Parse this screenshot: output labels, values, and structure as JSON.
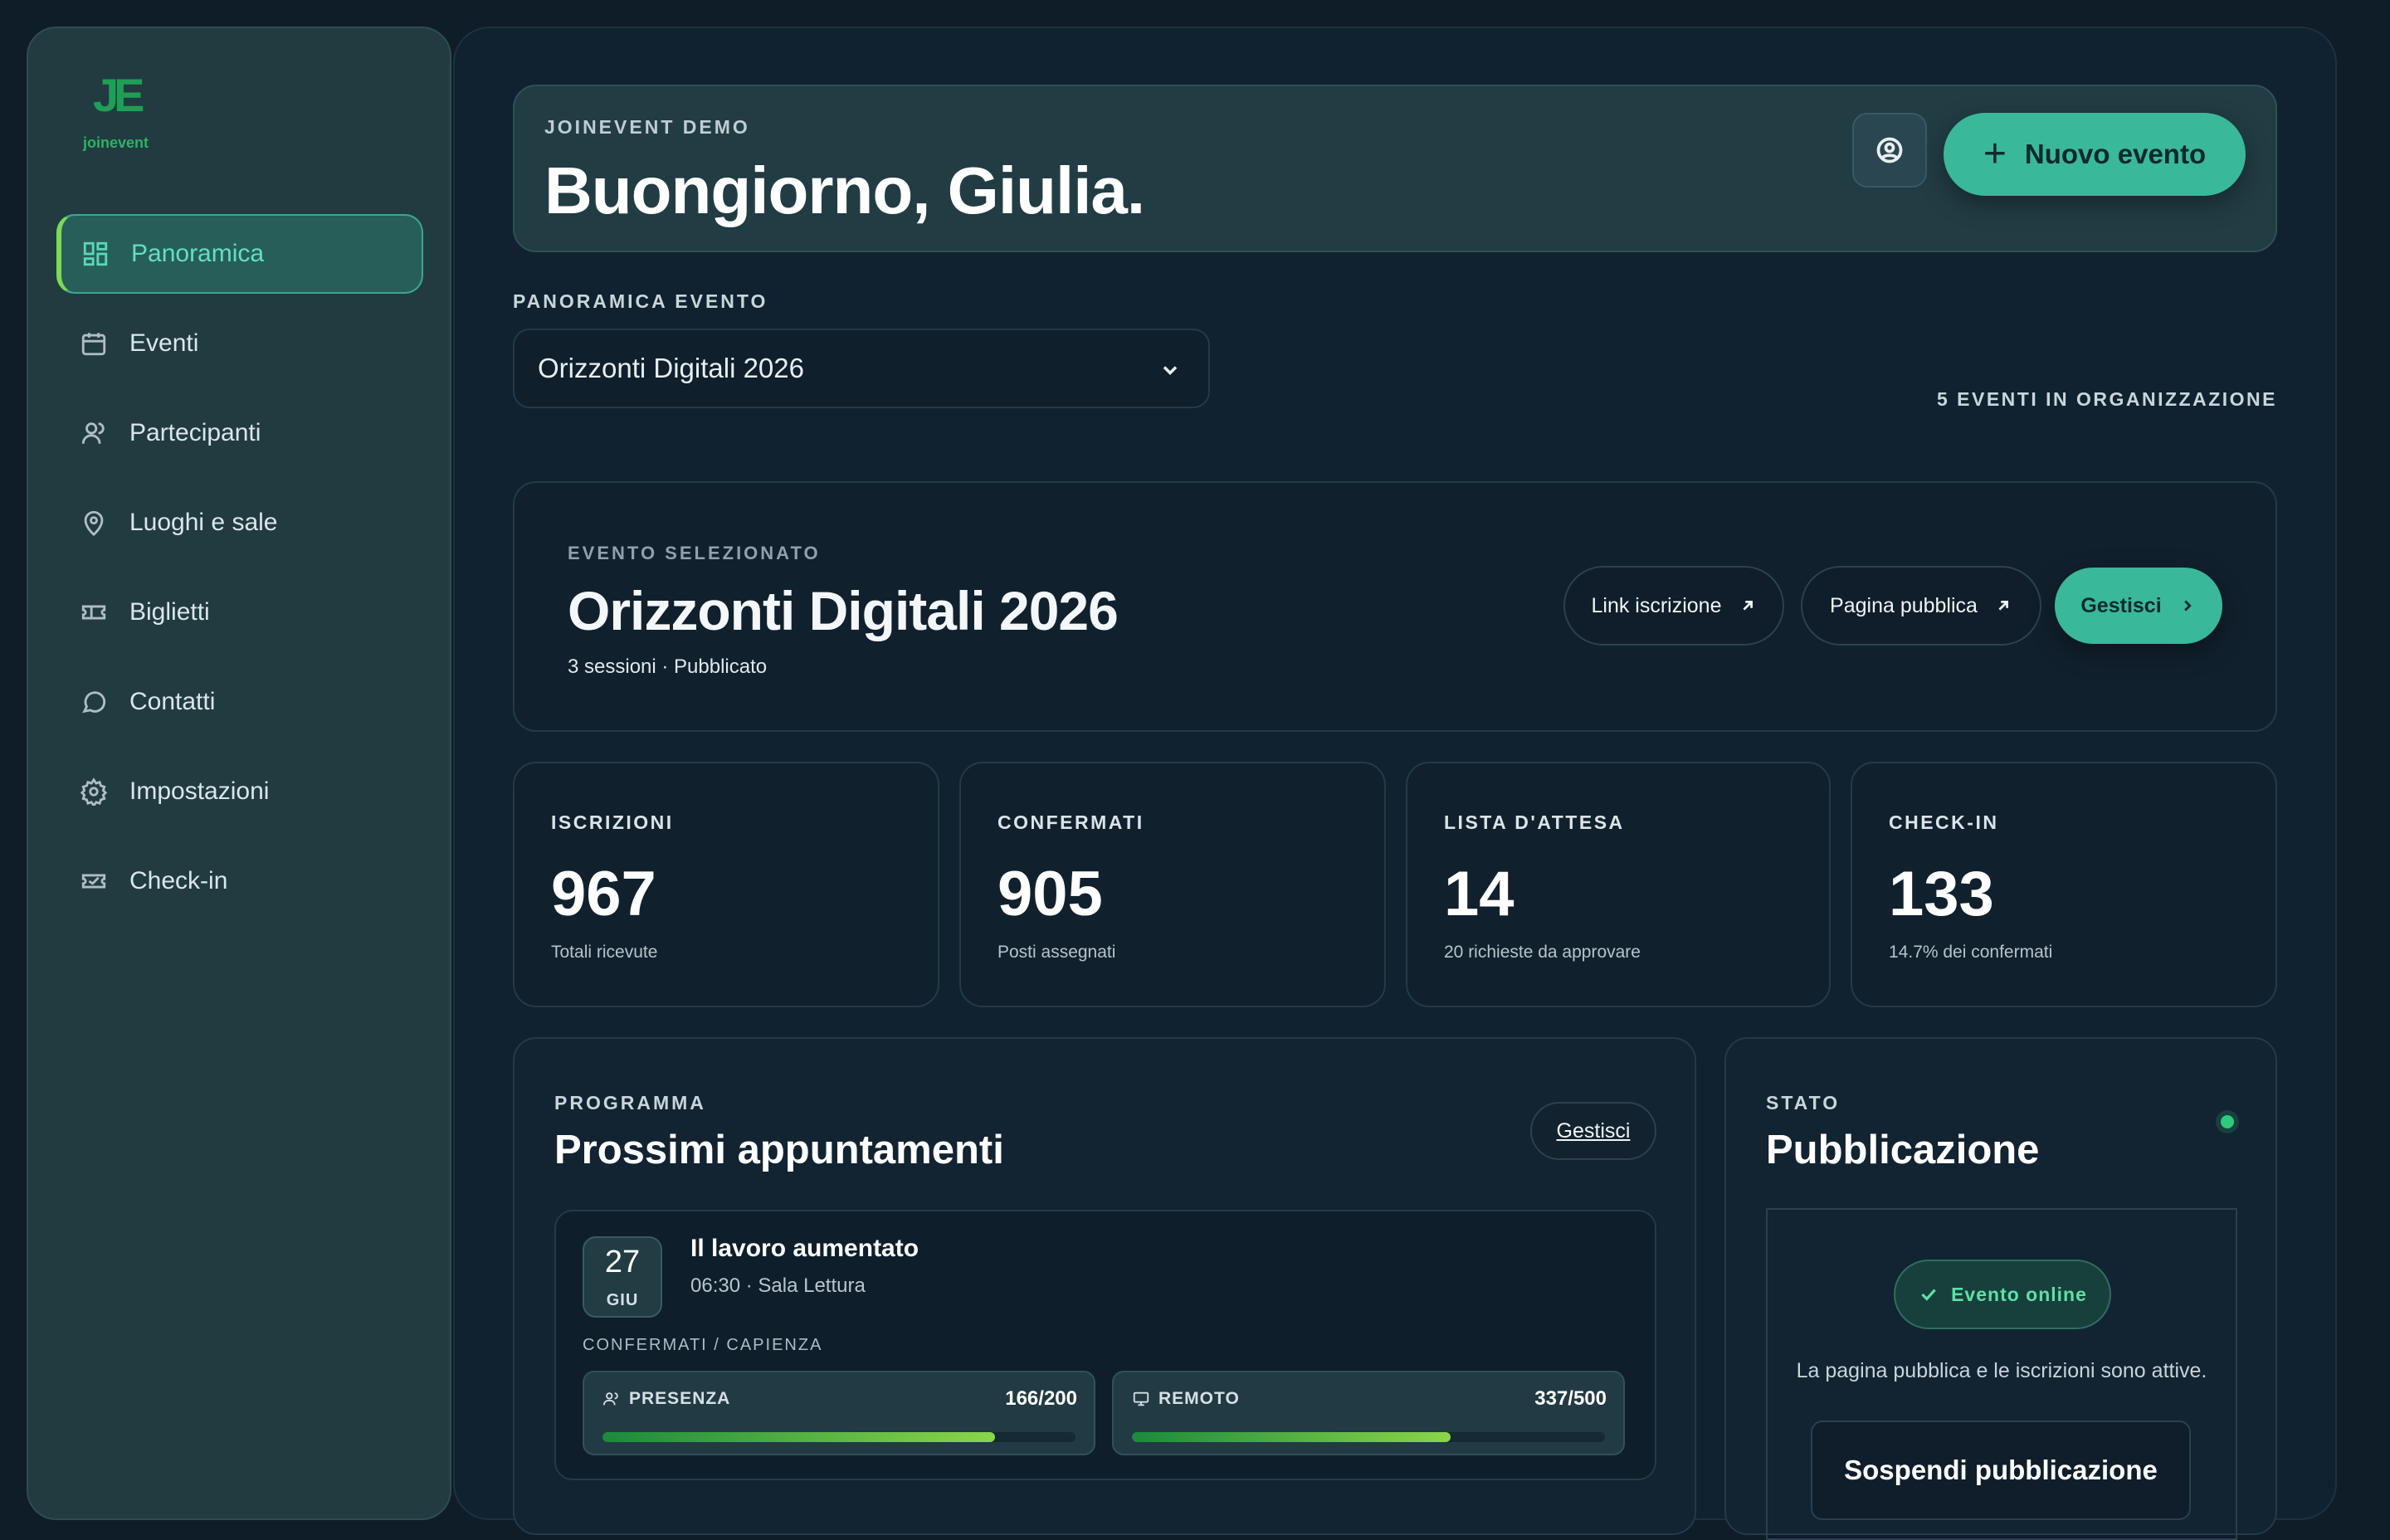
{
  "brand": {
    "logo_mark": "JE",
    "logo_word": "joinevent"
  },
  "sidebar": {
    "items": [
      {
        "label": "Panoramica",
        "icon": "dashboard-icon",
        "active": true
      },
      {
        "label": "Eventi",
        "icon": "calendar-icon"
      },
      {
        "label": "Partecipanti",
        "icon": "user-icon"
      },
      {
        "label": "Luoghi e sale",
        "icon": "map-pin-icon"
      },
      {
        "label": "Biglietti",
        "icon": "ticket-icon"
      },
      {
        "label": "Contatti",
        "icon": "chat-bubble-icon"
      },
      {
        "label": "Impostazioni",
        "icon": "gear-icon"
      },
      {
        "label": "Check-in",
        "icon": "ticket-check-icon"
      }
    ]
  },
  "header": {
    "kicker": "JOINEVENT DEMO",
    "greeting": "Buongiorno, Giulia.",
    "new_event_label": "Nuovo evento"
  },
  "overview": {
    "label": "PANORAMICA EVENTO",
    "selected_event": "Orizzonti Digitali 2026",
    "events_count": "5 EVENTI IN ORGANIZZAZIONE"
  },
  "selected": {
    "kicker": "EVENTO SELEZIONATO",
    "title": "Orizzonti Digitali 2026",
    "meta": "3 sessioni · Pubblicato",
    "link_label": "Link iscrizione",
    "public_label": "Pagina pubblica",
    "manage_label": "Gestisci"
  },
  "stats": [
    {
      "label": "ISCRIZIONI",
      "value": "967",
      "sub": "Totali ricevute"
    },
    {
      "label": "CONFERMATI",
      "value": "905",
      "sub": "Posti assegnati"
    },
    {
      "label": "LISTA D'ATTESA",
      "value": "14",
      "sub": "20 richieste da approvare"
    },
    {
      "label": "CHECK-IN",
      "value": "133",
      "sub": "14.7% dei confermati"
    }
  ],
  "program": {
    "kicker": "PROGRAMMA",
    "title": "Prossimi appuntamenti",
    "manage_label": "Gestisci",
    "session": {
      "day": "27",
      "month": "GIU",
      "title": "Il lavoro aumentato",
      "meta": "06:30 · Sala Lettura",
      "capacity_label": "CONFERMATI / CAPIENZA",
      "presence": {
        "label": "PRESENZA",
        "value": "166/200",
        "fraction": 0.83
      },
      "remote": {
        "label": "REMOTO",
        "value": "337/500",
        "fraction": 0.674
      }
    }
  },
  "publication": {
    "kicker": "STATO",
    "title": "Pubblicazione",
    "status": "Evento online",
    "info": "La pagina pubblica e le iscrizioni sono attive.",
    "suspend_label": "Sospendi pubblicazione"
  },
  "colors": {
    "accent": "#3ab89a",
    "background": "#0f1d29",
    "sidebar": "#213b41",
    "online": "#5fe0a4"
  }
}
